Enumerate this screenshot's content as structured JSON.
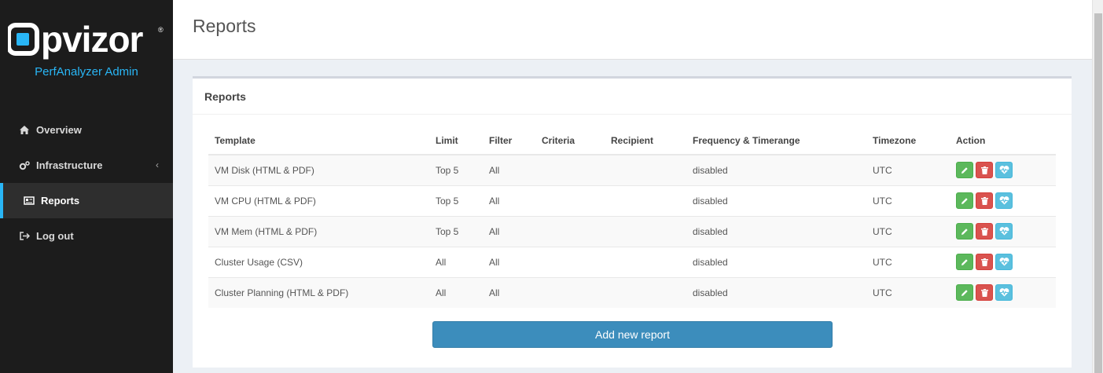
{
  "brand": {
    "logo_text": "opvizor",
    "subtitle": "PerfAnalyzer Admin"
  },
  "sidebar": {
    "items": [
      {
        "label": "Overview",
        "icon": "home-icon"
      },
      {
        "label": "Infrastructure",
        "icon": "gears-icon",
        "chevron": "‹"
      },
      {
        "label": "Reports",
        "icon": "newspaper-icon",
        "active": true
      },
      {
        "label": "Log out",
        "icon": "sign-out-icon"
      }
    ]
  },
  "header": {
    "title": "Reports"
  },
  "box": {
    "title": "Reports",
    "add_button": "Add new report"
  },
  "table": {
    "headers": [
      "Template",
      "Limit",
      "Filter",
      "Criteria",
      "Recipient",
      "Frequency & Timerange",
      "Timezone",
      "Action"
    ],
    "rows": [
      [
        "VM Disk (HTML & PDF)",
        "Top 5",
        "All",
        "",
        "",
        "disabled",
        "UTC"
      ],
      [
        "VM CPU (HTML & PDF)",
        "Top 5",
        "All",
        "",
        "",
        "disabled",
        "UTC"
      ],
      [
        "VM Mem (HTML & PDF)",
        "Top 5",
        "All",
        "",
        "",
        "disabled",
        "UTC"
      ],
      [
        "Cluster Usage (CSV)",
        "All",
        "All",
        "",
        "",
        "disabled",
        "UTC"
      ],
      [
        "Cluster Planning (HTML & PDF)",
        "All",
        "All",
        "",
        "",
        "disabled",
        "UTC"
      ]
    ]
  },
  "colors": {
    "accent": "#29b6f6",
    "primary": "#3c8dbc",
    "success": "#5cb85c",
    "danger": "#d9534f",
    "info": "#5bc0de",
    "sidebar": "#1c1c1c"
  }
}
